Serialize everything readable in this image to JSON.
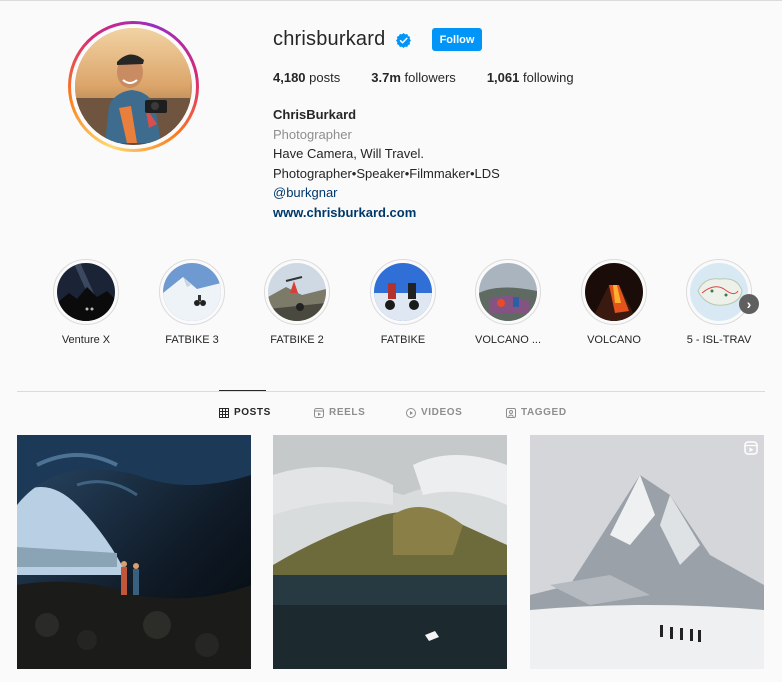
{
  "profile": {
    "username": "chrisburkard",
    "follow_label": "Follow",
    "stats": {
      "posts_count": "4,180",
      "posts_label": "posts",
      "followers_count": "3.7m",
      "followers_label": "followers",
      "following_count": "1,061",
      "following_label": "following"
    },
    "bio": {
      "full_name": "ChrisBurkard",
      "category": "Photographer",
      "line1": "Have Camera, Will Travel.",
      "line2": "Photographer•Speaker•Filmmaker•LDS",
      "mention": "@burkgnar",
      "website": "www.chrisburkard.com"
    }
  },
  "highlights": [
    {
      "label": "Venture X"
    },
    {
      "label": "FATBIKE 3"
    },
    {
      "label": "FATBIKE 2"
    },
    {
      "label": "FATBIKE"
    },
    {
      "label": "VOLCANO ..."
    },
    {
      "label": "VOLCANO"
    },
    {
      "label": "5 - ISL-TRAV"
    }
  ],
  "tabs": [
    {
      "label": "POSTS",
      "icon": "grid-icon",
      "active": true
    },
    {
      "label": "REELS",
      "icon": "reels-icon",
      "active": false
    },
    {
      "label": "VIDEOS",
      "icon": "play-icon",
      "active": false
    },
    {
      "label": "TAGGED",
      "icon": "tag-icon",
      "active": false
    }
  ],
  "colors": {
    "accent": "#0095f6",
    "link": "#00376b",
    "muted": "#8e8e8e",
    "border": "#dbdbdb",
    "background": "#fafafa"
  }
}
